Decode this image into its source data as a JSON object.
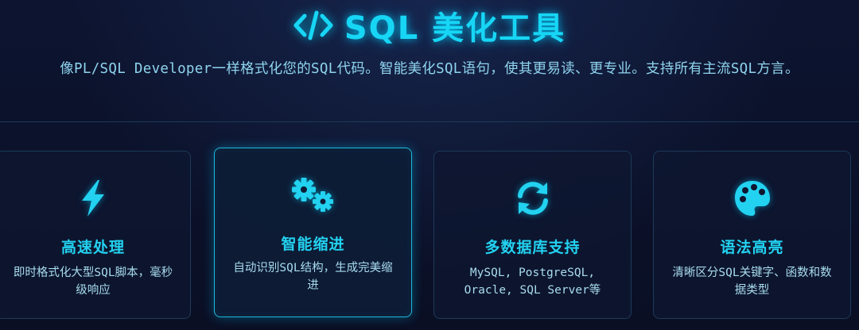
{
  "header": {
    "title": "SQL 美化工具",
    "subtitle": "像PL/SQL Developer一样格式化您的SQL代码。智能美化SQL语句，使其更易读、更专业。支持所有主流SQL方言。"
  },
  "features": [
    {
      "icon": "lightning-bolt-icon",
      "title": "高速处理",
      "desc": "即时格式化大型SQL脚本，毫秒级响应"
    },
    {
      "icon": "gears-icon",
      "title": "智能缩进",
      "desc": "自动识别SQL结构，生成完美缩进"
    },
    {
      "icon": "sync-arrows-icon",
      "title": "多数据库支持",
      "desc": "MySQL, PostgreSQL, Oracle, SQL Server等"
    },
    {
      "icon": "palette-icon",
      "title": "语法高亮",
      "desc": "清晰区分SQL关键字、函数和数据类型"
    }
  ],
  "colors": {
    "accent": "#17d6f5",
    "background": "#0b1024",
    "card_border": "#1c3a5a",
    "card_active_border": "#1fb8d6",
    "text": "#a8dcee"
  }
}
